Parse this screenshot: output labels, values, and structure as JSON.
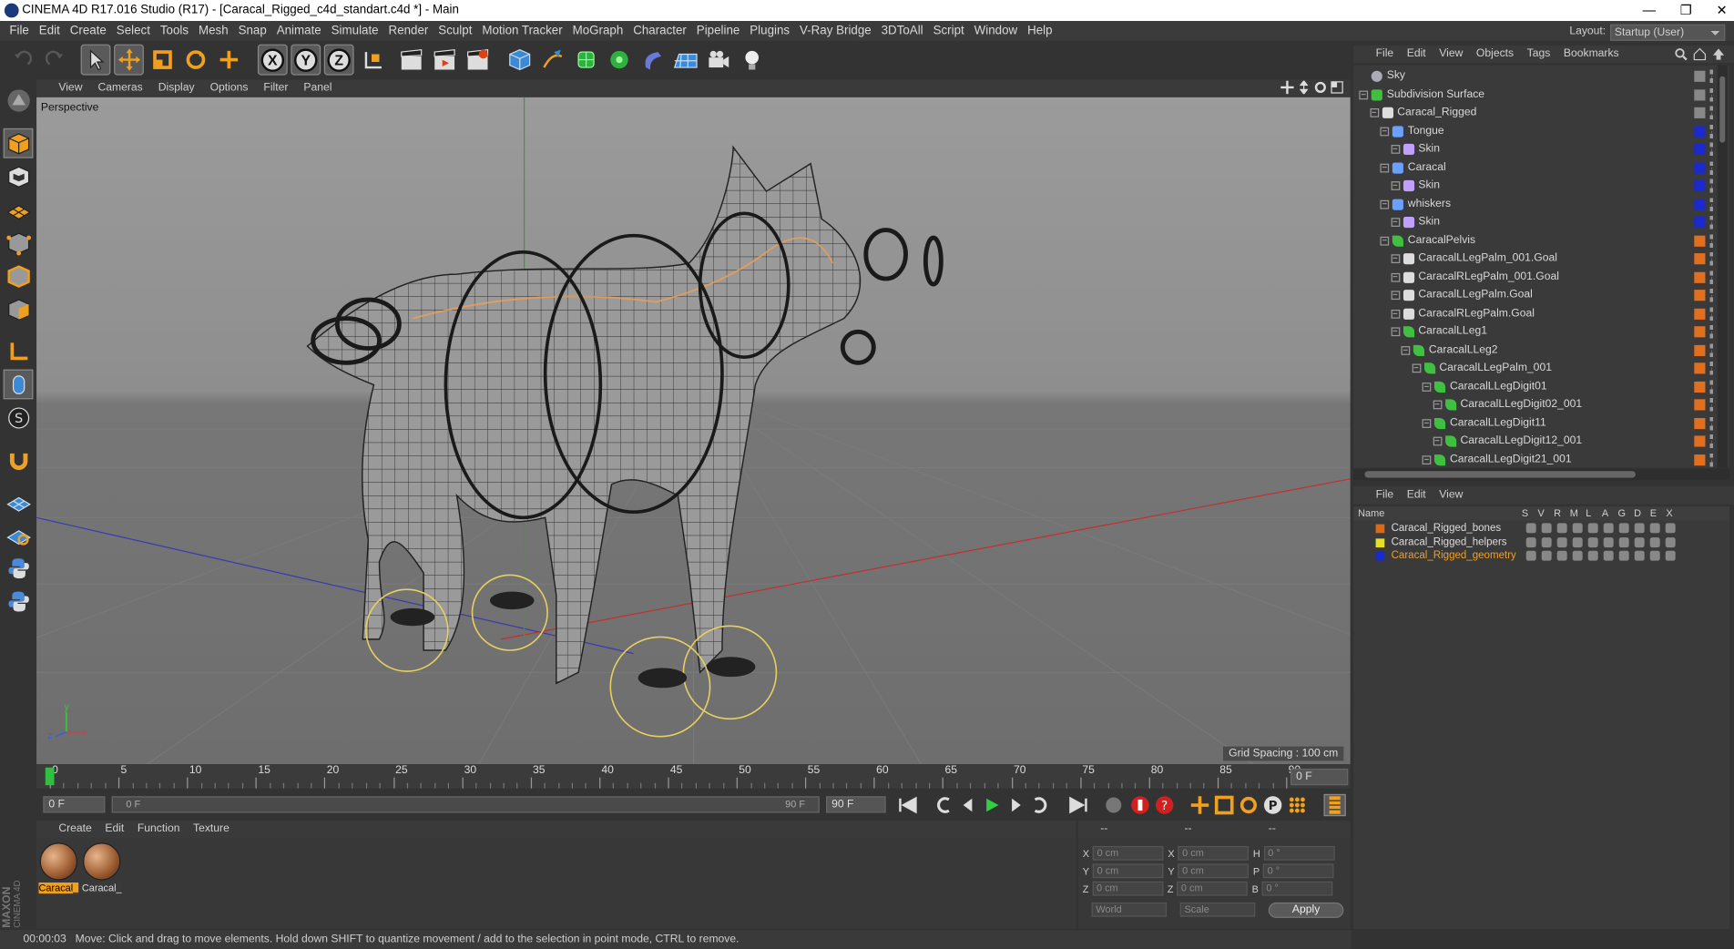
{
  "window": {
    "title": "CINEMA 4D R17.016 Studio (R17) - [Caracal_Rigged_c4d_standart.c4d *] - Main",
    "controls": [
      "—",
      "❐",
      "✕"
    ]
  },
  "menu": [
    "File",
    "Edit",
    "Create",
    "Select",
    "Tools",
    "Mesh",
    "Snap",
    "Animate",
    "Simulate",
    "Render",
    "Sculpt",
    "Motion Tracker",
    "MoGraph",
    "Character",
    "Pipeline",
    "Plugins",
    "V-Ray Bridge",
    "3DToAll",
    "Script",
    "Window",
    "Help"
  ],
  "layout": {
    "label": "Layout:",
    "value": "Startup (User)"
  },
  "toolbar": {
    "axis_x": "X",
    "axis_y": "Y",
    "axis_z": "Z"
  },
  "viewport": {
    "menu": [
      "View",
      "Cameras",
      "Display",
      "Options",
      "Filter",
      "Panel"
    ],
    "label": "Perspective",
    "grid_spacing": "Grid Spacing : 100 cm",
    "axis_y": "y",
    "axis_x": "x",
    "axis_z": "z"
  },
  "timeline": {
    "ticks": [
      "0",
      "5",
      "10",
      "15",
      "20",
      "25",
      "30",
      "35",
      "40",
      "45",
      "50",
      "55",
      "60",
      "65",
      "70",
      "75",
      "80",
      "85",
      "90"
    ],
    "current_frame": "0 F",
    "start_field": "0 F",
    "range_start": "0 F",
    "range_end": "90 F",
    "end_field": "90 F"
  },
  "materials": {
    "menu": [
      "Create",
      "Edit",
      "Function",
      "Texture"
    ],
    "items": [
      {
        "label": "Caracal_",
        "selected": true
      },
      {
        "label": "Caracal_",
        "selected": false
      }
    ]
  },
  "coords": {
    "header": [
      "--",
      "--",
      "--"
    ],
    "rows": [
      {
        "a": "X",
        "av": "0 cm",
        "b": "X",
        "bv": "0 cm",
        "c": "H",
        "cv": "0 °"
      },
      {
        "a": "Y",
        "av": "0 cm",
        "b": "Y",
        "bv": "0 cm",
        "c": "P",
        "cv": "0 °"
      },
      {
        "a": "Z",
        "av": "0 cm",
        "b": "Z",
        "bv": "0 cm",
        "c": "B",
        "cv": "0 °"
      }
    ],
    "world": "World",
    "scale": "Scale",
    "apply": "Apply"
  },
  "status": {
    "time": "00:00:03",
    "message": "Move: Click and drag to move elements. Hold down SHIFT to quantize movement / add to the selection in point mode, CTRL to remove."
  },
  "objects": {
    "menu": [
      "File",
      "Edit",
      "View",
      "Objects",
      "Tags",
      "Bookmarks"
    ],
    "items": [
      {
        "name": "Sky",
        "depth": 0,
        "icon": "sky-icon",
        "tag": "#888888"
      },
      {
        "name": "Subdivision Surface",
        "depth": 0,
        "icon": "subdivision-icon",
        "tag": "#888888"
      },
      {
        "name": "Caracal_Rigged",
        "depth": 1,
        "icon": "null-icon",
        "tag": "#888888"
      },
      {
        "name": "Tongue",
        "depth": 2,
        "icon": "mesh-icon",
        "tag": "#1a2acc"
      },
      {
        "name": "Skin",
        "depth": 3,
        "icon": "skin-icon",
        "tag": "#1a2acc"
      },
      {
        "name": "Caracal",
        "depth": 2,
        "icon": "mesh-icon",
        "tag": "#1a2acc"
      },
      {
        "name": "Skin",
        "depth": 3,
        "icon": "skin-icon",
        "tag": "#1a2acc"
      },
      {
        "name": "whiskers",
        "depth": 2,
        "icon": "mesh-icon",
        "tag": "#1a2acc"
      },
      {
        "name": "Skin",
        "depth": 3,
        "icon": "skin-icon",
        "tag": "#1a2acc"
      },
      {
        "name": "CaracalPelvis",
        "depth": 2,
        "icon": "joint-icon",
        "tag": "#e07020"
      },
      {
        "name": "CaracalLLegPalm_001.Goal",
        "depth": 3,
        "icon": "null-icon",
        "tag": "#e07020"
      },
      {
        "name": "CaracalRLegPalm_001.Goal",
        "depth": 3,
        "icon": "null-icon",
        "tag": "#e07020"
      },
      {
        "name": "CaracalLLegPalm.Goal",
        "depth": 3,
        "icon": "null-icon",
        "tag": "#e07020"
      },
      {
        "name": "CaracalRLegPalm.Goal",
        "depth": 3,
        "icon": "null-icon",
        "tag": "#e07020"
      },
      {
        "name": "CaracalLLeg1",
        "depth": 3,
        "icon": "joint-icon",
        "tag": "#e07020"
      },
      {
        "name": "CaracalLLeg2",
        "depth": 4,
        "icon": "joint-icon",
        "tag": "#e07020"
      },
      {
        "name": "CaracalLLegPalm_001",
        "depth": 5,
        "icon": "joint-icon",
        "tag": "#e07020"
      },
      {
        "name": "CaracalLLegDigit01",
        "depth": 6,
        "icon": "joint-icon",
        "tag": "#e07020"
      },
      {
        "name": "CaracalLLegDigit02_001",
        "depth": 7,
        "icon": "joint-icon",
        "tag": "#e07020"
      },
      {
        "name": "CaracalLLegDigit11",
        "depth": 6,
        "icon": "joint-icon",
        "tag": "#e07020"
      },
      {
        "name": "CaracalLLegDigit12_001",
        "depth": 7,
        "icon": "joint-icon",
        "tag": "#e07020"
      },
      {
        "name": "CaracalLLegDigit21_001",
        "depth": 6,
        "icon": "joint-icon",
        "tag": "#e07020"
      }
    ]
  },
  "layers": {
    "menu": [
      "File",
      "Edit",
      "View"
    ],
    "columns": [
      "Name",
      "S",
      "V",
      "R",
      "M",
      "L",
      "A",
      "G",
      "D",
      "E",
      "X"
    ],
    "items": [
      {
        "name": "Caracal_Rigged_bones",
        "color": "#d86a1a",
        "active": false
      },
      {
        "name": "Caracal_Rigged_helpers",
        "color": "#e6e020",
        "active": false
      },
      {
        "name": "Caracal_Rigged_geometry",
        "color": "#1a2acc",
        "active": true
      }
    ]
  }
}
